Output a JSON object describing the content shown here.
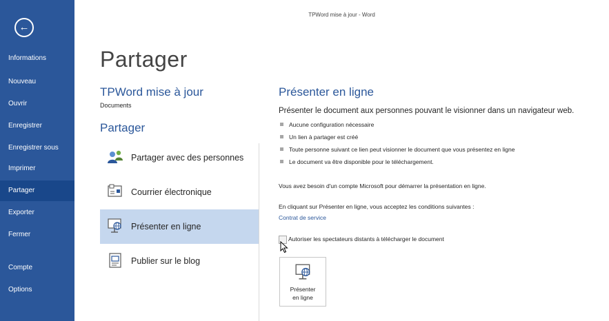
{
  "window": {
    "title": "TPWord mise à jour - Word"
  },
  "nav": {
    "back_glyph": "←",
    "items": [
      {
        "label": "Informations"
      },
      {
        "label": "Nouveau"
      },
      {
        "label": "Ouvrir"
      },
      {
        "label": "Enregistrer"
      },
      {
        "label": "Enregistrer sous"
      },
      {
        "label": "Imprimer"
      },
      {
        "label": "Partager",
        "active": true
      },
      {
        "label": "Exporter"
      },
      {
        "label": "Fermer"
      },
      {
        "label": "Compte"
      },
      {
        "label": "Options"
      }
    ]
  },
  "main": {
    "page_title": "Partager",
    "document_name": "TPWord mise à jour",
    "document_location": "Documents",
    "section_heading": "Partager",
    "options": [
      {
        "label": "Partager avec des personnes",
        "icon": "people-icon"
      },
      {
        "label": "Courrier électronique",
        "icon": "envelope-icon"
      },
      {
        "label": "Présenter en ligne",
        "icon": "present-online-icon",
        "selected": true
      },
      {
        "label": "Publier sur le blog",
        "icon": "blog-icon"
      }
    ]
  },
  "panel": {
    "title": "Présenter en ligne",
    "intro": "Présenter le document aux personnes pouvant le visionner dans un navigateur web.",
    "bullets": [
      "Aucune configuration nécessaire",
      "Un lien à partager est créé",
      "Toute personne suivant ce lien peut visionner le document que vous présentez en ligne",
      "Le document va être disponible pour le téléchargement."
    ],
    "account_note": "Vous avez besoin d'un compte Microsoft pour démarrer la présentation en ligne.",
    "terms_text": "En cliquant sur Présenter en ligne, vous acceptez les conditions suivantes :",
    "terms_link": "Contrat de service",
    "checkbox_label": "Autoriser les spectateurs distants à télécharger le document",
    "checkbox_checked": false,
    "button_line1": "Présenter",
    "button_line2": "en ligne"
  },
  "colors": {
    "nav_bg": "#2b579a",
    "nav_active": "#19478a",
    "accent": "#2b579a",
    "selected_bg": "#c5d7ee"
  }
}
